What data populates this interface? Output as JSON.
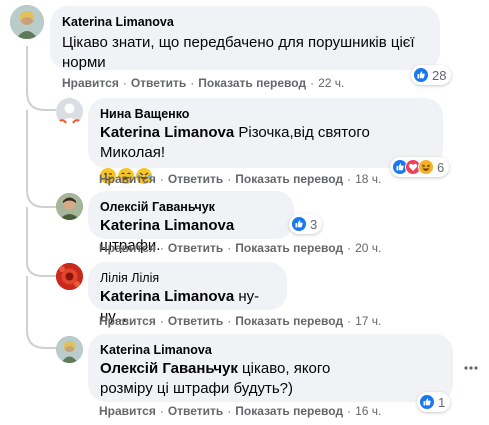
{
  "actions": {
    "like": "Нравится",
    "reply": "Ответить",
    "translate": "Показать перевод",
    "sep": "·"
  },
  "comments": [
    {
      "author": "Katerina Limanova",
      "text": "Цікаво знати, що передбачено для порушників цієї норми",
      "time": "22 ч.",
      "reaction_count": "28"
    },
    {
      "author": "Нина Ващенко",
      "mention": "Katerina Limanova",
      "text": " Різочка,від святого Миколая!",
      "time": "18 ч.",
      "reaction_count": "6"
    },
    {
      "author": "Олексій Гаваньчук",
      "mention": "Katerina Limanova",
      "text": " штрафи.",
      "time": "20 ч.",
      "reaction_count": "3"
    },
    {
      "author": "Лілія Лілія",
      "mention": "Katerina Limanova",
      "text": " ну-ну...",
      "time": "17 ч."
    },
    {
      "author": "Katerina Limanova",
      "mention": "Олексій Гаваньчук",
      "text": " цікаво, якого розміру ці штрафи будуть?)",
      "time": "16 ч.",
      "reaction_count": "1"
    }
  ],
  "colors": {
    "bubble": "#f0f2f5",
    "meta": "#65676b",
    "like": "#1877f2",
    "love": "#f33e58",
    "haha": "#f7b125"
  }
}
